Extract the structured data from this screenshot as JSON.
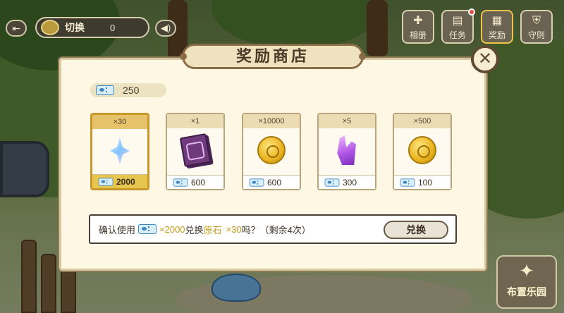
{
  "hud": {
    "back_icon": "back-arrow-icon",
    "switch_label": "切换",
    "switch_count": "0",
    "sound_icon": "speaker-icon",
    "buttons": [
      {
        "label": "相册",
        "icon": "puzzle-icon"
      },
      {
        "label": "任务",
        "icon": "task-book-icon"
      },
      {
        "label": "奖励",
        "icon": "gift-box-icon"
      },
      {
        "label": "守则",
        "icon": "shield-icon"
      }
    ]
  },
  "shop": {
    "title": "奖励商店",
    "close_icon": "close-icon",
    "balance": "250",
    "items": [
      {
        "quantity": "×30",
        "price": "2000",
        "icon": "primogem-icon",
        "selected": true
      },
      {
        "quantity": "×1",
        "price": "600",
        "icon": "book-icon",
        "selected": false
      },
      {
        "quantity": "×10000",
        "price": "600",
        "icon": "mora-coin-icon",
        "selected": false
      },
      {
        "quantity": "×5",
        "price": "300",
        "icon": "purple-crystal-icon",
        "selected": false
      },
      {
        "quantity": "×500",
        "price": "100",
        "icon": "mora-coin-icon",
        "selected": false
      }
    ],
    "confirm": {
      "prefix": "确认使用",
      "cost": "×2000",
      "middle": "兑换",
      "item_name": "原石",
      "item_qty": "×30",
      "suffix": "吗？（剩余4次）",
      "button": "兑换"
    }
  },
  "magic_button": {
    "label": "布置乐园",
    "icon": "magic-wand-icon"
  },
  "colors": {
    "accent": "#c9982a",
    "panel": "#fdf7e3",
    "ticket": "#3c88c4"
  }
}
